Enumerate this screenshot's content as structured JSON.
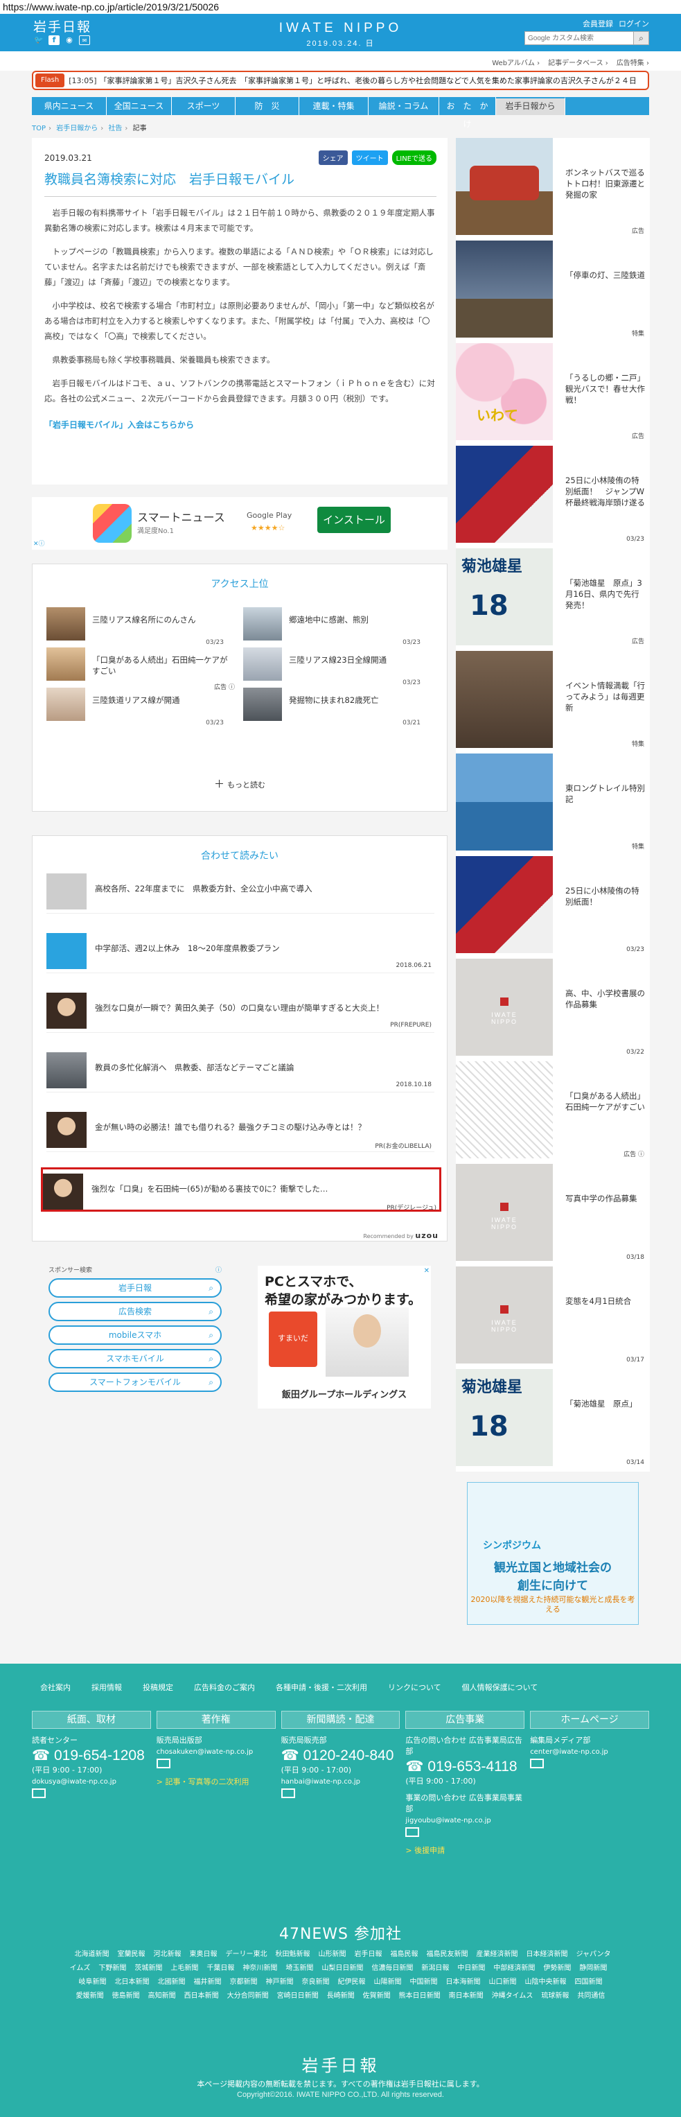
{
  "url": "https://www.iwate-np.co.jp/article/2019/3/21/50026",
  "header": {
    "logo_jp": "岩手日報",
    "brand": "IWATE NIPPO",
    "date": "2019.03.24. 日",
    "links": [
      "会員登録",
      "ログイン"
    ],
    "search_placeholder": "Google カスタム検索",
    "social": [
      "twitter",
      "facebook",
      "line",
      "mail"
    ]
  },
  "servicebar": {
    "links": [
      "Webアルバム ›",
      "記事データベース ›",
      "広告特集 ›"
    ]
  },
  "flash": {
    "label": "Flash",
    "time": "[13:05]",
    "text": "「家事評論家第１号」吉沢久子さん死去　「家事評論家第１号」と呼ばれ、老後の暮らし方や社会問題などで人気を集めた家事評論家の吉沢久子さんが２４日"
  },
  "nav": [
    {
      "label": "県内ニュース",
      "w": 108
    },
    {
      "label": "全国ニュース",
      "w": 94
    },
    {
      "label": "スポーツ",
      "w": 92
    },
    {
      "label": "防　災",
      "w": 92
    },
    {
      "label": "連載・特集",
      "w": 100
    },
    {
      "label": "論説・コラム",
      "w": 102
    },
    {
      "label": "お　た　か　け",
      "w": 82
    },
    {
      "label": "岩手日報から",
      "w": 100
    }
  ],
  "breadcrumb": [
    "TOP",
    "岩手日報から",
    "社告",
    "記事"
  ],
  "article": {
    "date": "2019.03.21",
    "share": [
      "シェア",
      "ツイート",
      "LINEで送る"
    ],
    "title": "教職員名簿検索に対応　岩手日報モバイル",
    "paragraphs": [
      "岩手日報の有料携帯サイト「岩手日報モバイル」は２１日午前１０時から、県教委の２０１９年度定期人事異動名簿の検索に対応します。検索は４月末まで可能です。",
      "トップページの「教職員検索」から入ります。複数の単語による「ＡＮＤ検索」や「ＯＲ検索」には対応していません。名字または名前だけでも検索できますが、一部を検索語として入力してください。例えば「斎藤」「渡辺」は「斉藤」「渡辺」での検索となります。",
      "小中学校は、校名で検索する場合「市町村立」は原則必要ありませんが、「岡小」「第一中」など類似校名がある場合は市町村立を入力すると検索しやすくなります。また、「附属学校」は「付属」で入力、高校は「〇高校」ではなく「〇高」で検索してください。",
      "県教委事務局も除く学校事務職員、栄養職員も検索できます。",
      "岩手日報モバイルはドコモ、ａｕ、ソフトバンクの携帯電話とスマートフォン（ｉＰｈｏｎｅを含む）に対応。各社の公式メニュー、２次元バーコードから会員登録できます。月額３００円（税別）です。"
    ],
    "link": "「岩手日報モバイル」入会はこちらから"
  },
  "smartnews": {
    "title": "スマートニュース",
    "sub": "満足度No.1",
    "gp": "Google Play",
    "stars": "★★★★☆",
    "install": "インストール",
    "adx": "✕ⓘ"
  },
  "access": {
    "title": "アクセス上位",
    "items": [
      {
        "text": "三陸リアス線名所にのんさん",
        "date": "03/23",
        "img": "ph-a"
      },
      {
        "text": "郷遠地中に感謝、熊別",
        "date": "03/23",
        "img": "ph-b"
      },
      {
        "text": "「口臭がある人続出」石田純一ケアがすごい",
        "date": "",
        "badge": "広告 ⓘ",
        "img": "ph-c"
      },
      {
        "text": "三陸リアス線23日全線開通",
        "date": "03/23",
        "img": "ph-d"
      },
      {
        "text": "三陸鉄道リアス線が開通",
        "date": "03/23",
        "img": "ph-e"
      },
      {
        "text": "発掘物に扶まれ82歳死亡",
        "date": "03/21",
        "img": "ph-f"
      }
    ],
    "more": "もっと読む"
  },
  "related": {
    "title": "合わせて読みたい",
    "items": [
      {
        "text": "高校各所、22年度までに　県教委方針、全公立小中高で導入",
        "meta": "",
        "img": "ph-gray"
      },
      {
        "text": "中学部活、週2以上休み　18〜20年度県教委プラン",
        "meta": "2018.06.21",
        "img": "ph-blue"
      },
      {
        "text": "強烈な口臭が一瞬で？黄田久美子（50）の口臭ない理由が簡単すぎると大炎上！",
        "meta": "PR(FREPURE)",
        "img": "ph-face"
      },
      {
        "text": "教員の多忙化解消へ　県教委、部活などテーマごと議論",
        "meta": "2018.10.18",
        "img": "ph-f"
      },
      {
        "text": "金が無い時の必勝法！誰でも借りれる？最強クチコミの駆け込み寺とは！？",
        "meta": "PR(お金のLIBELLA)",
        "img": "ph-face"
      },
      {
        "text": "強烈な「口臭」を石田純一(65)が勧める裏技で0に？衝撃でした…",
        "meta": "PR(デジレージュ)",
        "img": "ph-face"
      }
    ],
    "recommended": "Recommended by",
    "uzou": "uzou"
  },
  "sponsor": {
    "label": "スポンサー検索",
    "info": "ⓘ",
    "buttons": [
      "岩手日報",
      "広告検索",
      "mobileスマホ",
      "スマホモバイル",
      "スマートフォンモバイル"
    ]
  },
  "ad_iida": {
    "headline_1": "PCとスマホで、",
    "headline_2": "希望の家がみつかります。",
    "house_label": "すまいだ",
    "brand": "飯田グループホールディングス",
    "close": "✕"
  },
  "sidebar": [
    {
      "text": "ボンネットバスで巡るトトロ村！旧東源遷と発掘の家",
      "badge": "広告",
      "img": "ph-bus"
    },
    {
      "text": "「停車の灯、三陸鉄道",
      "badge": "特集",
      "img": "ph-rail"
    },
    {
      "text": "「うるしの郷・二戸」観光バスで！春せ大作戦！",
      "badge": "広告",
      "img": "ph-flower"
    },
    {
      "text": "25日に小林陵侑の特別紙面！　ジャンプW杯最終戦海岸頭け遂る",
      "badge": "03/23",
      "img": "ph-ski"
    },
    {
      "text": "「菊池雄星　原点」3月16日、県内で先行発売！",
      "badge": "広告",
      "img": "ph-kiku"
    },
    {
      "text": "イベント情報満載「行ってみよう」は毎週更新",
      "badge": "特集",
      "img": "ph-crowd"
    },
    {
      "text": "東ロングトレイル特別記",
      "badge": "特集",
      "img": "ph-trail"
    },
    {
      "text": "25日に小林陵侑の特別紙面！",
      "badge": "03/23",
      "img": "ph-ski"
    },
    {
      "text": "高、中、小学校書展の作品募集",
      "badge": "03/22",
      "img": "ph-nippo"
    },
    {
      "text": "「口臭がある人続出」石田純一ケアがすごい",
      "badge": "広告 ⓘ",
      "img": "ph-sketch"
    },
    {
      "text": "写真中学の作品募集",
      "badge": "03/18",
      "img": "ph-nippo"
    },
    {
      "text": "変態を4月1日統合",
      "badge": "03/17",
      "img": "ph-nippo"
    },
    {
      "text": "「菊池雄星　原点」",
      "badge": "03/14",
      "img": "ph-kiku"
    }
  ],
  "side_banner": {
    "label": "シンポジウム",
    "title_1": "観光立国と地域社会の",
    "title_2": "創生に向けて",
    "sub": "2020以降を視据えた持続可能な観光と成長を考える"
  },
  "footer": {
    "links": [
      "会社案内",
      "採用情報",
      "投稿規定",
      "広告料金のご案内",
      "各種申請・後援・二次利用",
      "リンクについて",
      "個人情報保護について"
    ],
    "cols": [
      {
        "head": "紙面、取材",
        "label": "読者センター",
        "tel": "019-654-1208",
        "hours": "(平日 9:00 - 17:00)",
        "email": "dokusya@iwate-np.co.jp",
        "extra": ""
      },
      {
        "head": "著作権",
        "label": "販売局出版部",
        "tel": "",
        "hours": "",
        "email": "chosakuken@iwate-np.co.jp",
        "extra": "> 記事・写真等の二次利用"
      },
      {
        "head": "新聞購読・配達",
        "label": "販売局販売部",
        "tel": "0120-240-840",
        "hours": "(平日 9:00 - 17:00)",
        "email": "hanbai@iwate-np.co.jp",
        "extra": ""
      },
      {
        "head": "広告事業",
        "label": "広告の問い合わせ 広告事業局広告部",
        "tel": "019-653-4118",
        "hours": "(平日 9:00 - 17:00)",
        "email": "jigyoubu@iwate-np.co.jp",
        "extra": "> 後援申請"
      },
      {
        "head": "ホームページ",
        "label": "編集局メディア部",
        "tel": "",
        "hours": "",
        "email": "center@iwate-np.co.jp",
        "extra": ""
      }
    ],
    "jigyo_label": "事業の問い合わせ 広告事業局事業部",
    "news47": "47NEWS 参加社",
    "papers": [
      "北海道新聞",
      "室蘭民報",
      "河北新報",
      "東奥日報",
      "デーリー東北",
      "秋田魁新報",
      "山形新聞",
      "岩手日報",
      "福島民報",
      "福島民友新聞",
      "産業経済新聞",
      "日本経済新聞",
      "ジャパンタイムズ",
      "下野新聞",
      "茨城新聞",
      "上毛新聞",
      "千葉日報",
      "神奈川新聞",
      "埼玉新聞",
      "山梨日日新聞",
      "信濃毎日新聞",
      "新潟日報",
      "中日新聞",
      "中部経済新聞",
      "伊勢新聞",
      "静岡新聞",
      "岐阜新聞",
      "北日本新聞",
      "北國新聞",
      "福井新聞",
      "京都新聞",
      "神戸新聞",
      "奈良新聞",
      "紀伊民報",
      "山陽新聞",
      "中国新聞",
      "日本海新聞",
      "山口新聞",
      "山陰中央新報",
      "四国新聞",
      "愛媛新聞",
      "徳島新聞",
      "高知新聞",
      "西日本新聞",
      "大分合同新聞",
      "宮崎日日新聞",
      "長崎新聞",
      "佐賀新聞",
      "熊本日日新聞",
      "南日本新聞",
      "沖縄タイムス",
      "琉球新報",
      "共同通信"
    ],
    "logo": "岩手日報",
    "note": "本ページ掲載内容の無断転載を禁じます。すべての著作権は岩手日報社に属します。",
    "copyright": "Copyright©2016. IWATE NIPPO CO.,LTD. All rights reserved."
  }
}
